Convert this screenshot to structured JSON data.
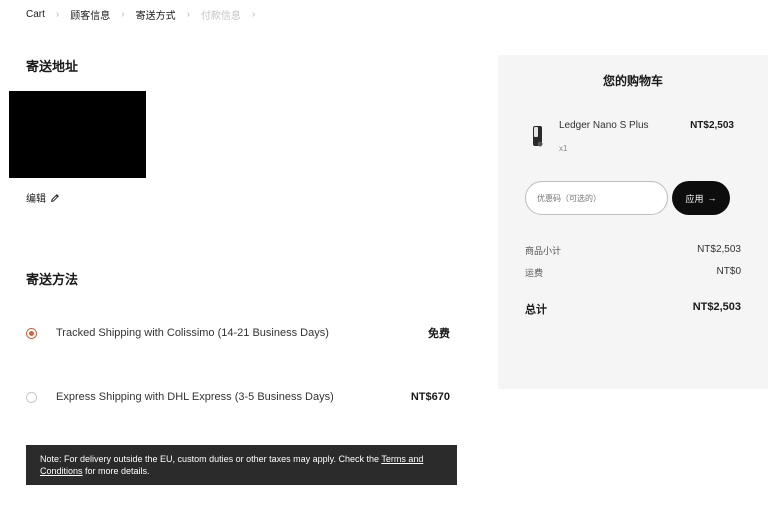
{
  "breadcrumb": {
    "items": [
      {
        "label": "Cart"
      },
      {
        "label": "顾客信息"
      },
      {
        "label": "寄送方式"
      },
      {
        "label": "付款信息"
      }
    ]
  },
  "shipping_address": {
    "title": "寄送地址",
    "edit_label": "编辑"
  },
  "shipping_method": {
    "title": "寄送方法",
    "options": [
      {
        "label": "Tracked Shipping with Colissimo (14-21 Business Days)",
        "price": "免费",
        "selected": true
      },
      {
        "label": "Express Shipping with DHL Express (3-5 Business Days)",
        "price": "NT$670",
        "selected": false
      }
    ]
  },
  "note": {
    "text_before": "Note: For delivery outside the EU, custom duties or other taxes may apply. Check the ",
    "link_text": "Terms and Conditions",
    "text_after": " for more details."
  },
  "cart": {
    "title": "您的购物车",
    "item": {
      "name": "Ledger Nano S Plus",
      "price": "NT$2,503",
      "quantity": "x1"
    },
    "coupon_placeholder": "优惠码（可选的）",
    "apply_label": "应用",
    "subtotal_label": "商品小计",
    "subtotal_value": "NT$2,503",
    "shipping_label": "运费",
    "shipping_value": "NT$0",
    "total_label": "总计",
    "total_value": "NT$2,503"
  },
  "colors": {
    "accent": "#d9603a",
    "note_bg": "#2b2b2b",
    "panel_bg": "#f5f5f5",
    "button_bg": "#0d0d0d"
  },
  "icons": [
    "chevron-right-icon",
    "pencil-icon",
    "arrow-right-icon",
    "product-thumbnail"
  ]
}
